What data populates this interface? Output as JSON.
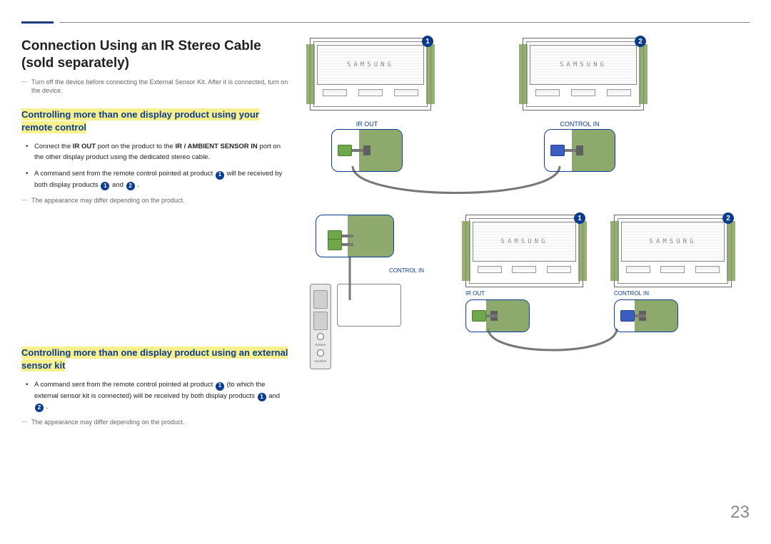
{
  "page_number": "23",
  "title": "Connection Using an IR Stereo Cable (sold separately)",
  "note_top": "Turn off the device before connecting the External Sensor Kit. After it is connected, turn on the device.",
  "section1": {
    "heading": "Controlling more than one display product using your remote control",
    "bullet1_a": "Connect the ",
    "bullet1_b": "IR OUT",
    "bullet1_c": " port on the product to the ",
    "bullet1_d": "IR / AMBIENT SENSOR IN",
    "bullet1_e": " port on the other display product using the dedicated stereo cable.",
    "bullet2_a": "A command sent from the remote control pointed at product ",
    "bullet2_b": " will be received by both display products ",
    "bullet2_c": " and ",
    "bullet2_d": " .",
    "note": "The appearance may differ depending on the product."
  },
  "section2": {
    "heading": "Controlling more than one display product using an external sensor kit",
    "bullet1_a": "A command sent from the remote control pointed at product ",
    "bullet1_b": " (to which the external sensor kit is connected) will be received by both display products ",
    "bullet1_c": " and ",
    "bullet1_d": " .",
    "note": "The appearance may differ depending on the product."
  },
  "labels": {
    "ir_out": "IR OUT",
    "control_in": "CONTROL IN",
    "brand": "SAMSUNG",
    "power": "POWER",
    "source": "SOURCE"
  },
  "badges": {
    "one": "1",
    "two": "2"
  }
}
